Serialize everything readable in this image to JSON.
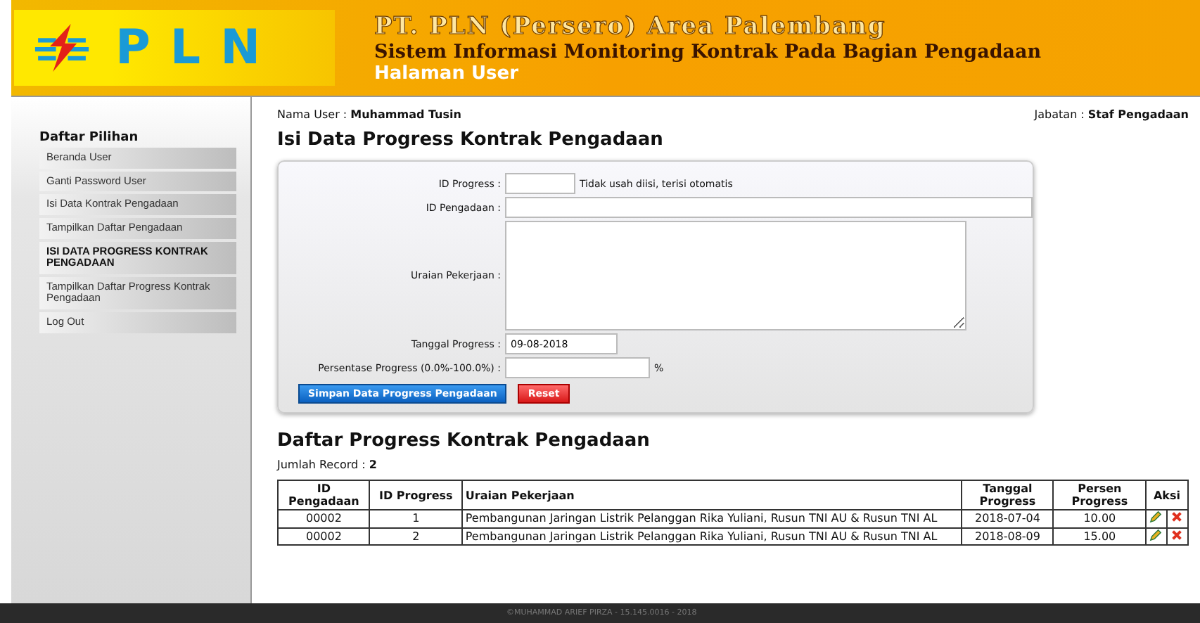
{
  "header": {
    "logo_text": "PLN",
    "company": "PT. PLN (Persero) Area Palembang",
    "system": "Sistem Informasi Monitoring Kontrak Pada Bagian Pengadaan",
    "page": "Halaman User"
  },
  "sidebar": {
    "title": "Daftar Pilihan",
    "items": [
      {
        "label": "Beranda User",
        "selected": false
      },
      {
        "label": "Ganti Password User",
        "selected": false
      },
      {
        "label": "Isi Data Kontrak Pengadaan",
        "selected": false
      },
      {
        "label": "Tampilkan Daftar Pengadaan",
        "selected": false
      },
      {
        "label": "ISI DATA PROGRESS KONTRAK PENGADAAN",
        "selected": true
      },
      {
        "label": "Tampilkan Daftar Progress Kontrak Pengadaan",
        "selected": false
      },
      {
        "label": "Log Out",
        "selected": false
      }
    ]
  },
  "user": {
    "name_label": "Nama User :",
    "name": "Muhammad Tusin",
    "role_label": "Jabatan :",
    "role": "Staf Pengadaan"
  },
  "form": {
    "title": "Isi Data Progress Kontrak Pengadaan",
    "id_progress_label": "ID Progress :",
    "id_progress_hint": "Tidak usah diisi, terisi otomatis",
    "id_pengadaan_label": "ID Pengadaan :",
    "uraian_label": "Uraian Pekerjaan :",
    "tanggal_label": "Tanggal Progress :",
    "tanggal_value": "09-08-2018",
    "persen_label": "Persentase Progress (0.0%-100.0%) :",
    "persen_unit": "%",
    "buttons": [
      "Simpan Data Progress Pengadaan",
      "Reset"
    ]
  },
  "list": {
    "title": "Daftar Progress Kontrak Pengadaan",
    "count_label": "Jumlah Record :",
    "count": "2",
    "columns": [
      "ID Pengadaan",
      "ID Progress",
      "Uraian Pekerjaan",
      "Tanggal Progress",
      "Persen Progress",
      "Aksi"
    ],
    "rows": [
      {
        "id_pengadaan": "00002",
        "id_progress": "1",
        "uraian": "Pembangunan Jaringan Listrik Pelanggan Rika Yuliani, Rusun TNI AU & Rusun TNI AL",
        "tanggal": "2018-07-04",
        "persen": "10.00"
      },
      {
        "id_pengadaan": "00002",
        "id_progress": "2",
        "uraian": "Pembangunan Jaringan Listrik Pelanggan Rika Yuliani, Rusun TNI AU & Rusun TNI AL",
        "tanggal": "2018-08-09",
        "persen": "15.00"
      }
    ]
  },
  "footer": "©MUHAMMAD ARIEF PIRZA - 15.145.0016 - 2018"
}
